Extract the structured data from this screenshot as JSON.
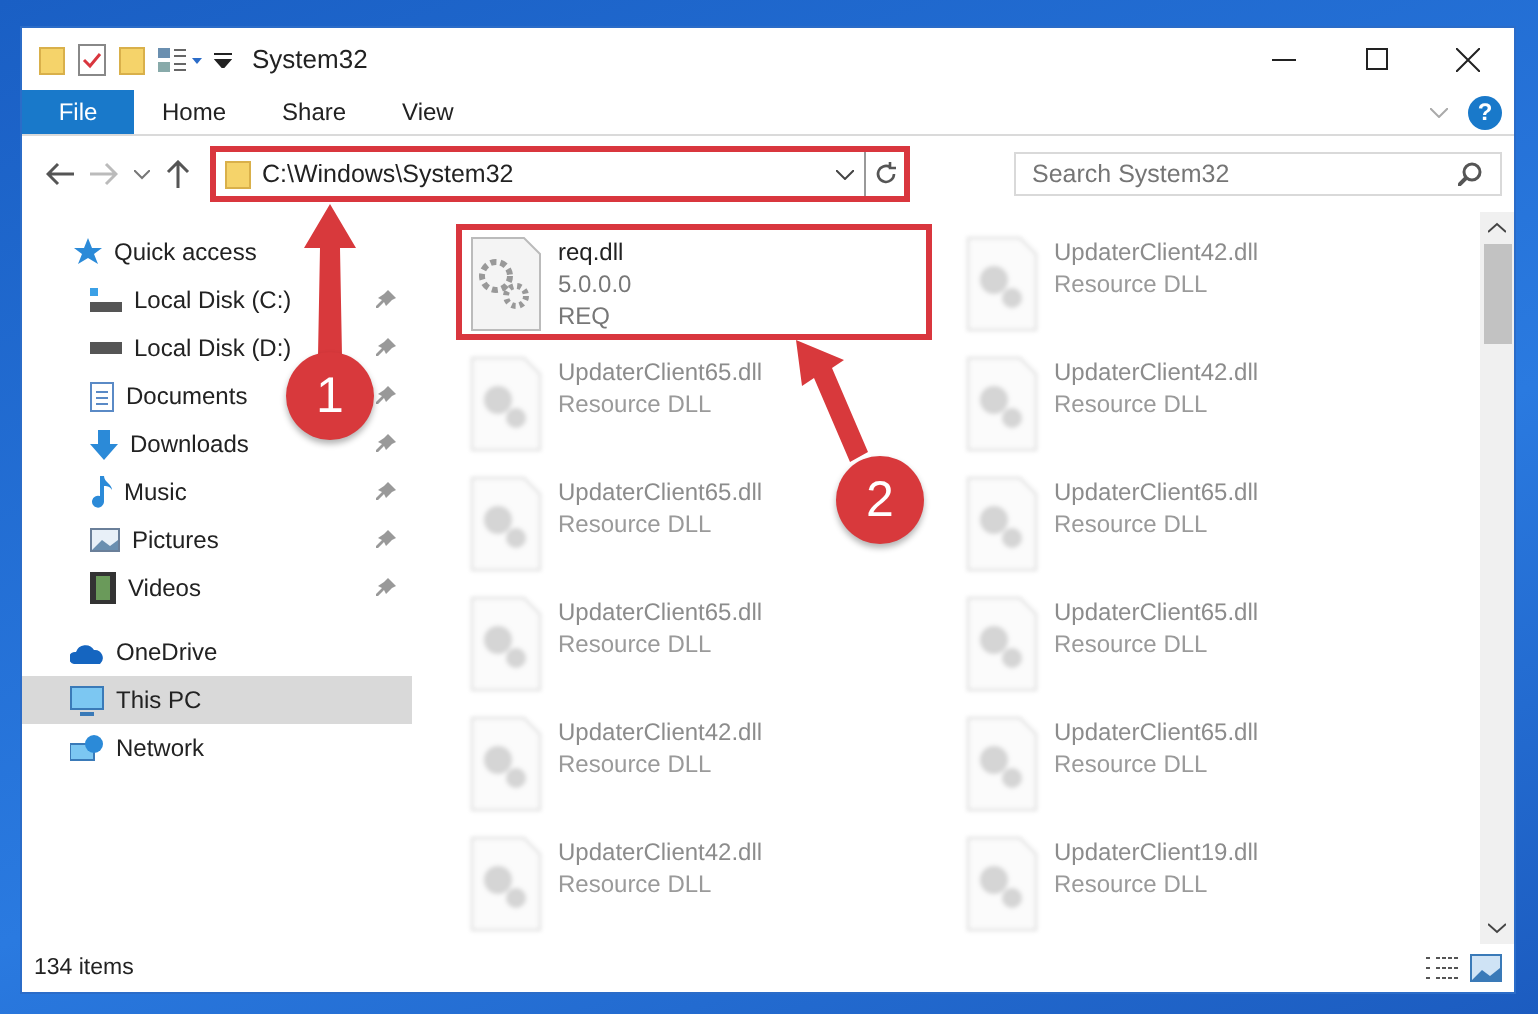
{
  "window": {
    "title": "System32"
  },
  "ribbon_tabs": [
    {
      "label": "File",
      "selected": true
    },
    {
      "label": "Home",
      "selected": false
    },
    {
      "label": "Share",
      "selected": false
    },
    {
      "label": "View",
      "selected": false
    }
  ],
  "address": {
    "path": "C:\\Windows\\System32",
    "annotated": true
  },
  "search": {
    "placeholder": "Search System32"
  },
  "help_button": "?",
  "nav": [
    {
      "label": "Quick access",
      "selected": false,
      "children": [
        {
          "label": "Local Disk (C:)",
          "selected": false,
          "pinned": true
        },
        {
          "label": "Local Disk (D:)",
          "selected": false,
          "pinned": true
        },
        {
          "label": "Documents",
          "selected": false,
          "pinned": true
        },
        {
          "label": "Downloads",
          "selected": false,
          "pinned": true
        },
        {
          "label": "Music",
          "selected": false,
          "pinned": true
        },
        {
          "label": "Pictures",
          "selected": false,
          "pinned": true
        },
        {
          "label": "Videos",
          "selected": false,
          "pinned": true
        }
      ]
    },
    {
      "label": "OneDrive",
      "selected": false
    },
    {
      "label": "This PC",
      "selected": true
    },
    {
      "label": "Network",
      "selected": false
    }
  ],
  "files": [
    {
      "name": "req.dll",
      "details": [
        "5.0.0.0",
        "REQ"
      ],
      "blurred": false,
      "annotated": true
    },
    {
      "name": "UpdaterClient42.dll",
      "details": [
        "Resource DLL"
      ],
      "blurred": true,
      "annotated": false
    },
    {
      "name": "UpdaterClient65.dll",
      "details": [
        "Resource DLL"
      ],
      "blurred": true,
      "annotated": false
    },
    {
      "name": "UpdaterClient42.dll",
      "details": [
        "Resource DLL"
      ],
      "blurred": true,
      "annotated": false
    },
    {
      "name": "UpdaterClient65.dll",
      "details": [
        "Resource DLL"
      ],
      "blurred": true,
      "annotated": false
    },
    {
      "name": "UpdaterClient65.dll",
      "details": [
        "Resource DLL"
      ],
      "blurred": true,
      "annotated": false
    },
    {
      "name": "UpdaterClient65.dll",
      "details": [
        "Resource DLL"
      ],
      "blurred": true,
      "annotated": false
    },
    {
      "name": "UpdaterClient65.dll",
      "details": [
        "Resource DLL"
      ],
      "blurred": true,
      "annotated": false
    },
    {
      "name": "UpdaterClient42.dll",
      "details": [
        "Resource DLL"
      ],
      "blurred": true,
      "annotated": false
    },
    {
      "name": "UpdaterClient65.dll",
      "details": [
        "Resource DLL"
      ],
      "blurred": true,
      "annotated": false
    },
    {
      "name": "UpdaterClient42.dll",
      "details": [
        "Resource DLL"
      ],
      "blurred": true,
      "annotated": false
    },
    {
      "name": "UpdaterClient19.dll",
      "details": [
        "Resource DLL"
      ],
      "blurred": true,
      "annotated": false
    }
  ],
  "callouts": [
    {
      "number": "1"
    },
    {
      "number": "2"
    }
  ],
  "status_bar": {
    "item_count": "134 items"
  }
}
